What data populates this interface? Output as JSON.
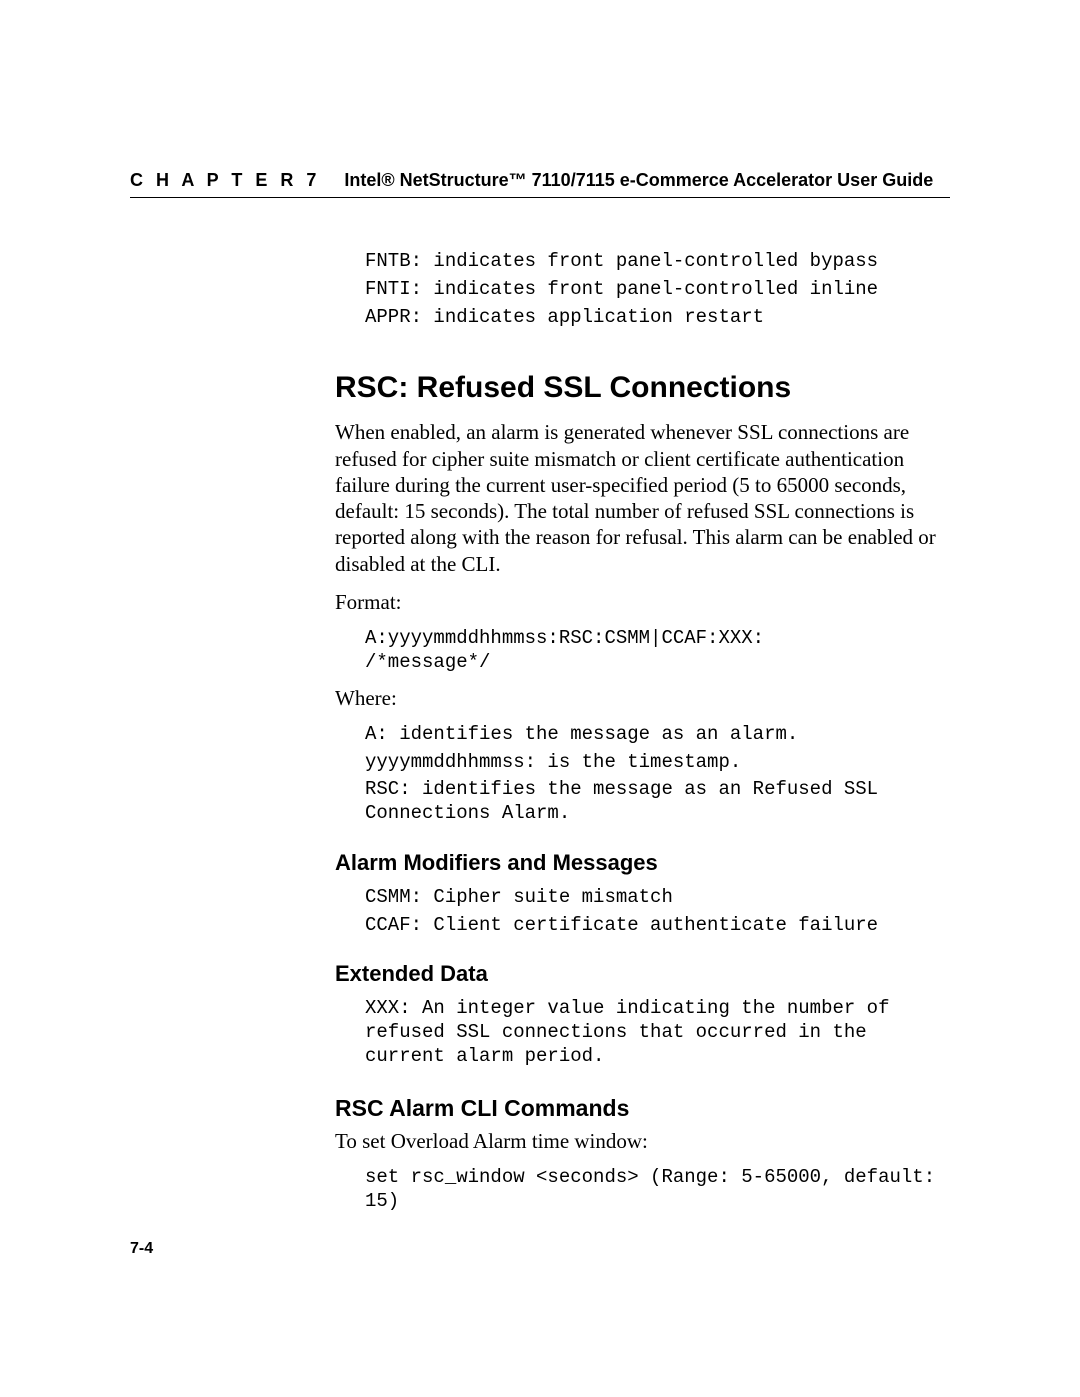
{
  "header": {
    "chapter_label": "C H A P T E R 7",
    "title": "Intel® NetStructure™ 7110/7115 e-Commerce Accelerator User Guide"
  },
  "intro_codes": {
    "fntb": "FNTB: indicates front panel-controlled bypass",
    "fnti": "FNTI: indicates front panel-controlled inline",
    "appr": "APPR: indicates application restart"
  },
  "section": {
    "title": "RSC: Refused SSL Connections",
    "paragraph": "When enabled, an alarm is generated whenever SSL connections are refused for cipher suite mismatch or client certificate authentication failure during the current user-specified period (5 to 65000 seconds, default: 15 seconds). The total number of refused SSL connections is reported along with the reason for refusal. This alarm can be enabled or disabled at the CLI.",
    "format_label": "Format:",
    "format_code": "A:yyyymmddhhmmss:RSC:CSMM|CCAF:XXX:\n/*message*/",
    "where_label": "Where:",
    "where_a": "A: identifies the message as an alarm.",
    "where_ts": "yyyymmddhhmmss: is the timestamp.",
    "where_rsc": "RSC: identifies the message as an Refused SSL Connections Alarm."
  },
  "alarm_modifiers": {
    "title": "Alarm Modifiers and Messages",
    "csmm": "CSMM: Cipher suite mismatch",
    "ccaf": "CCAF: Client certificate authenticate failure"
  },
  "extended_data": {
    "title": "Extended Data",
    "xxx": "XXX: An integer value indicating the number of refused SSL connections that occurred in the current alarm period."
  },
  "cli": {
    "title": "RSC Alarm CLI Commands",
    "intro": "To set Overload Alarm time window:",
    "cmd": "set rsc_window <seconds> (Range: 5-65000, default: 15)"
  },
  "page_number": "7-4"
}
